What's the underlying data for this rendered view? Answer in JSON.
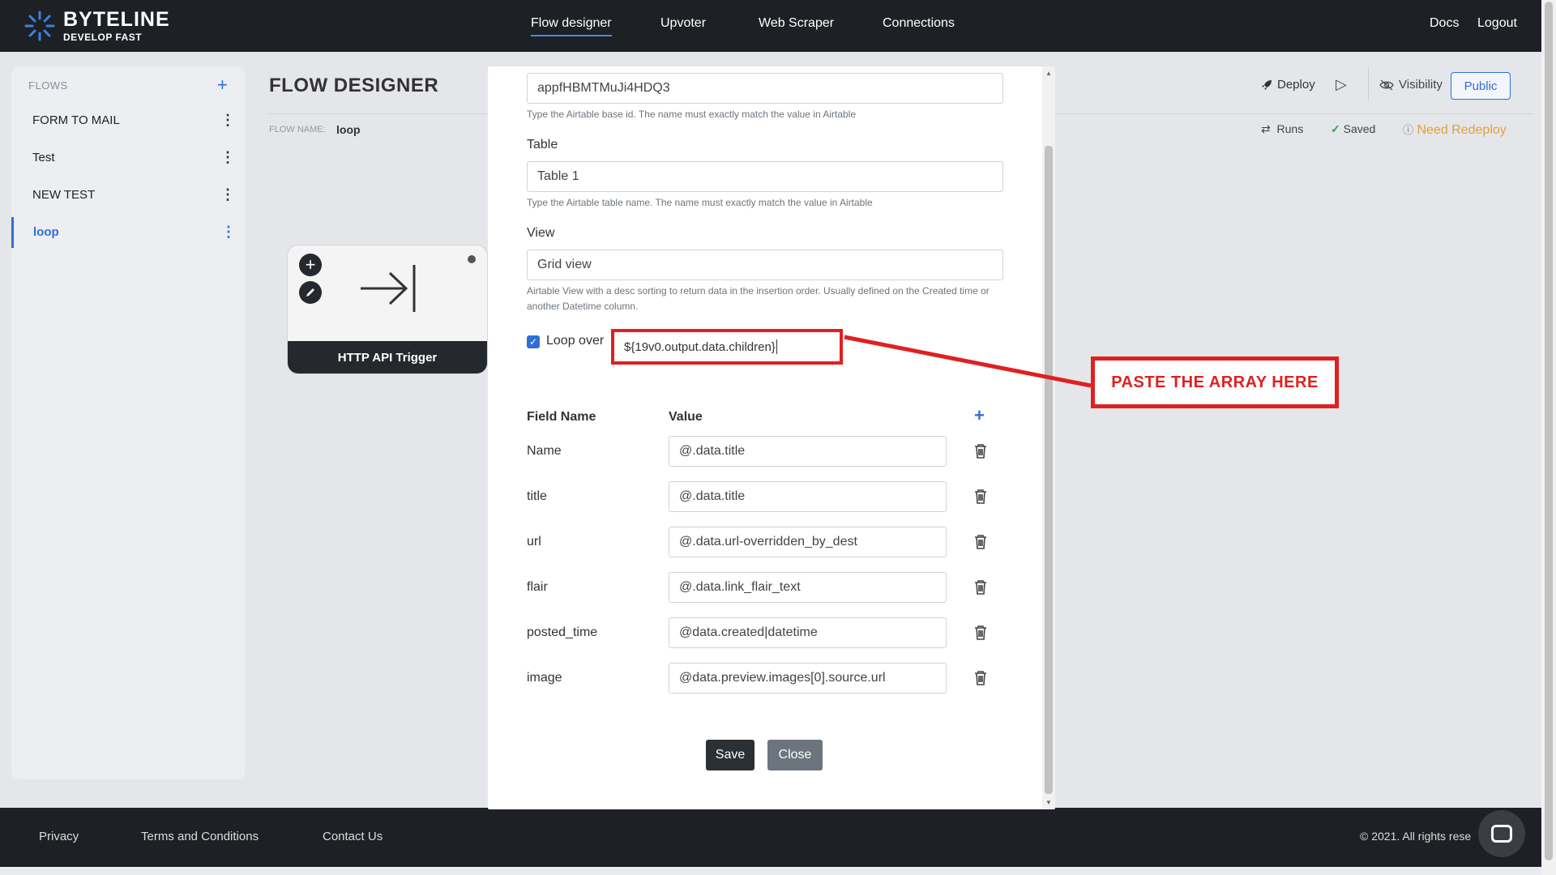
{
  "brand": {
    "name": "BYTELINE",
    "tagline": "DEVELOP FAST"
  },
  "nav": {
    "links": [
      "Flow designer",
      "Upvoter",
      "Web Scraper",
      "Connections"
    ],
    "right": [
      "Docs",
      "Logout"
    ]
  },
  "sidebar": {
    "heading": "FLOWS",
    "items": [
      {
        "label": "FORM TO MAIL"
      },
      {
        "label": "Test"
      },
      {
        "label": "NEW TEST"
      },
      {
        "label": "loop"
      }
    ]
  },
  "page": {
    "title": "FLOW DESIGNER",
    "flow_name_label": "FLOW NAME:",
    "flow_name": "loop",
    "deploy": "Deploy",
    "visibility": "Visibility",
    "public": "Public",
    "runs": "Runs",
    "saved": "Saved",
    "need_redeploy": "Need Redeploy"
  },
  "trigger": {
    "label": "HTTP API Trigger"
  },
  "modal": {
    "base_id_value": "appfHBMTMuJi4HDQ3",
    "base_id_help": "Type the Airtable base id. The name must exactly match the value in Airtable",
    "table_label": "Table",
    "table_value": "Table 1",
    "table_help": "Type the Airtable table name. The name must exactly match the value in Airtable",
    "view_label": "View",
    "view_value": "Grid view",
    "view_help": "Airtable View with a desc sorting to return data in the insertion order. Usually defined on the Created time or another Datetime column.",
    "loop_label": "Loop over",
    "loop_checked": true,
    "loop_value": "${19v0.output.data.children}",
    "field_name_header": "Field Name",
    "value_header": "Value",
    "fields": [
      {
        "name": "Name",
        "value": "@.data.title"
      },
      {
        "name": "title",
        "value": "@.data.title"
      },
      {
        "name": "url",
        "value": "@.data.url-overridden_by_dest"
      },
      {
        "name": "flair",
        "value": "@.data.link_flair_text"
      },
      {
        "name": "posted_time",
        "value": "@data.created|datetime"
      },
      {
        "name": "image",
        "value": "@data.preview.images[0].source.url"
      }
    ],
    "save": "Save",
    "close": "Close"
  },
  "annotation": {
    "text": "PASTE THE ARRAY HERE",
    "color": "#e02020"
  },
  "footer": {
    "links": [
      "Privacy",
      "Terms and Conditions",
      "Contact Us"
    ],
    "copyright": "© 2021. All rights rese"
  },
  "colors": {
    "accent": "#2f6fd6",
    "nav_bg": "#1d2024",
    "warning": "#e0a13a",
    "annotation": "#e02020"
  }
}
